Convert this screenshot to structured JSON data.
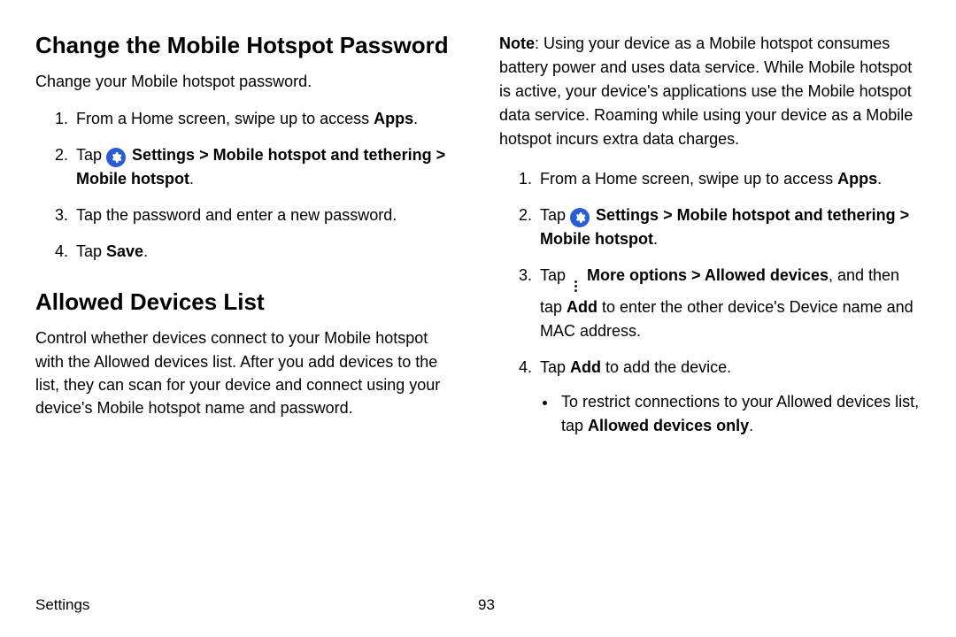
{
  "left": {
    "heading1": "Change the Mobile Hotspot Password",
    "lead1": "Change your Mobile hotspot password.",
    "steps1": {
      "s1_pre": "From a Home screen, swipe up to access ",
      "s1_b": "Apps",
      "s1_post": ".",
      "s2_pre": "Tap ",
      "s2_settings": "Settings",
      "s2_gt1": " > ",
      "s2_mht": "Mobile hotspot and tethering",
      "s2_gt2": " > ",
      "s2_mh": "Mobile hotspot",
      "s2_post": ".",
      "s3": "Tap the password and enter a new password.",
      "s4_pre": "Tap ",
      "s4_b": "Save",
      "s4_post": "."
    },
    "heading2": "Allowed Devices List",
    "lead2": "Control whether devices connect to your Mobile hotspot with the Allowed devices list. After you add devices to the list, they can scan for your device and connect using your device's Mobile hotspot name and password."
  },
  "right": {
    "note_b": "Note",
    "note_text": ": Using your device as a Mobile hotspot consumes battery power and uses data service. While Mobile hotspot is active, your device's applications use the Mobile hotspot data service. Roaming while using your device as a Mobile hotspot incurs extra data charges.",
    "steps": {
      "s1_pre": "From a Home screen, swipe up to access ",
      "s1_b": "Apps",
      "s1_post": ".",
      "s2_pre": "Tap ",
      "s2_settings": "Settings",
      "s2_gt1": " > ",
      "s2_mht": "Mobile hotspot and tethering",
      "s2_gt2": " > ",
      "s2_mh": "Mobile hotspot",
      "s2_post": ".",
      "s3_pre": "Tap ",
      "s3_more": "More options",
      "s3_gt": " > ",
      "s3_allowed": "Allowed devices",
      "s3_mid": ", and then tap ",
      "s3_add": "Add",
      "s3_post": " to enter the other device's Device name and MAC address.",
      "s4_pre": "Tap ",
      "s4_add": "Add",
      "s4_post": " to add the device.",
      "bullet_pre": "To restrict connections to your Allowed devices list, tap ",
      "bullet_b": "Allowed devices only",
      "bullet_post": "."
    }
  },
  "footer": {
    "section": "Settings",
    "page": "93"
  }
}
